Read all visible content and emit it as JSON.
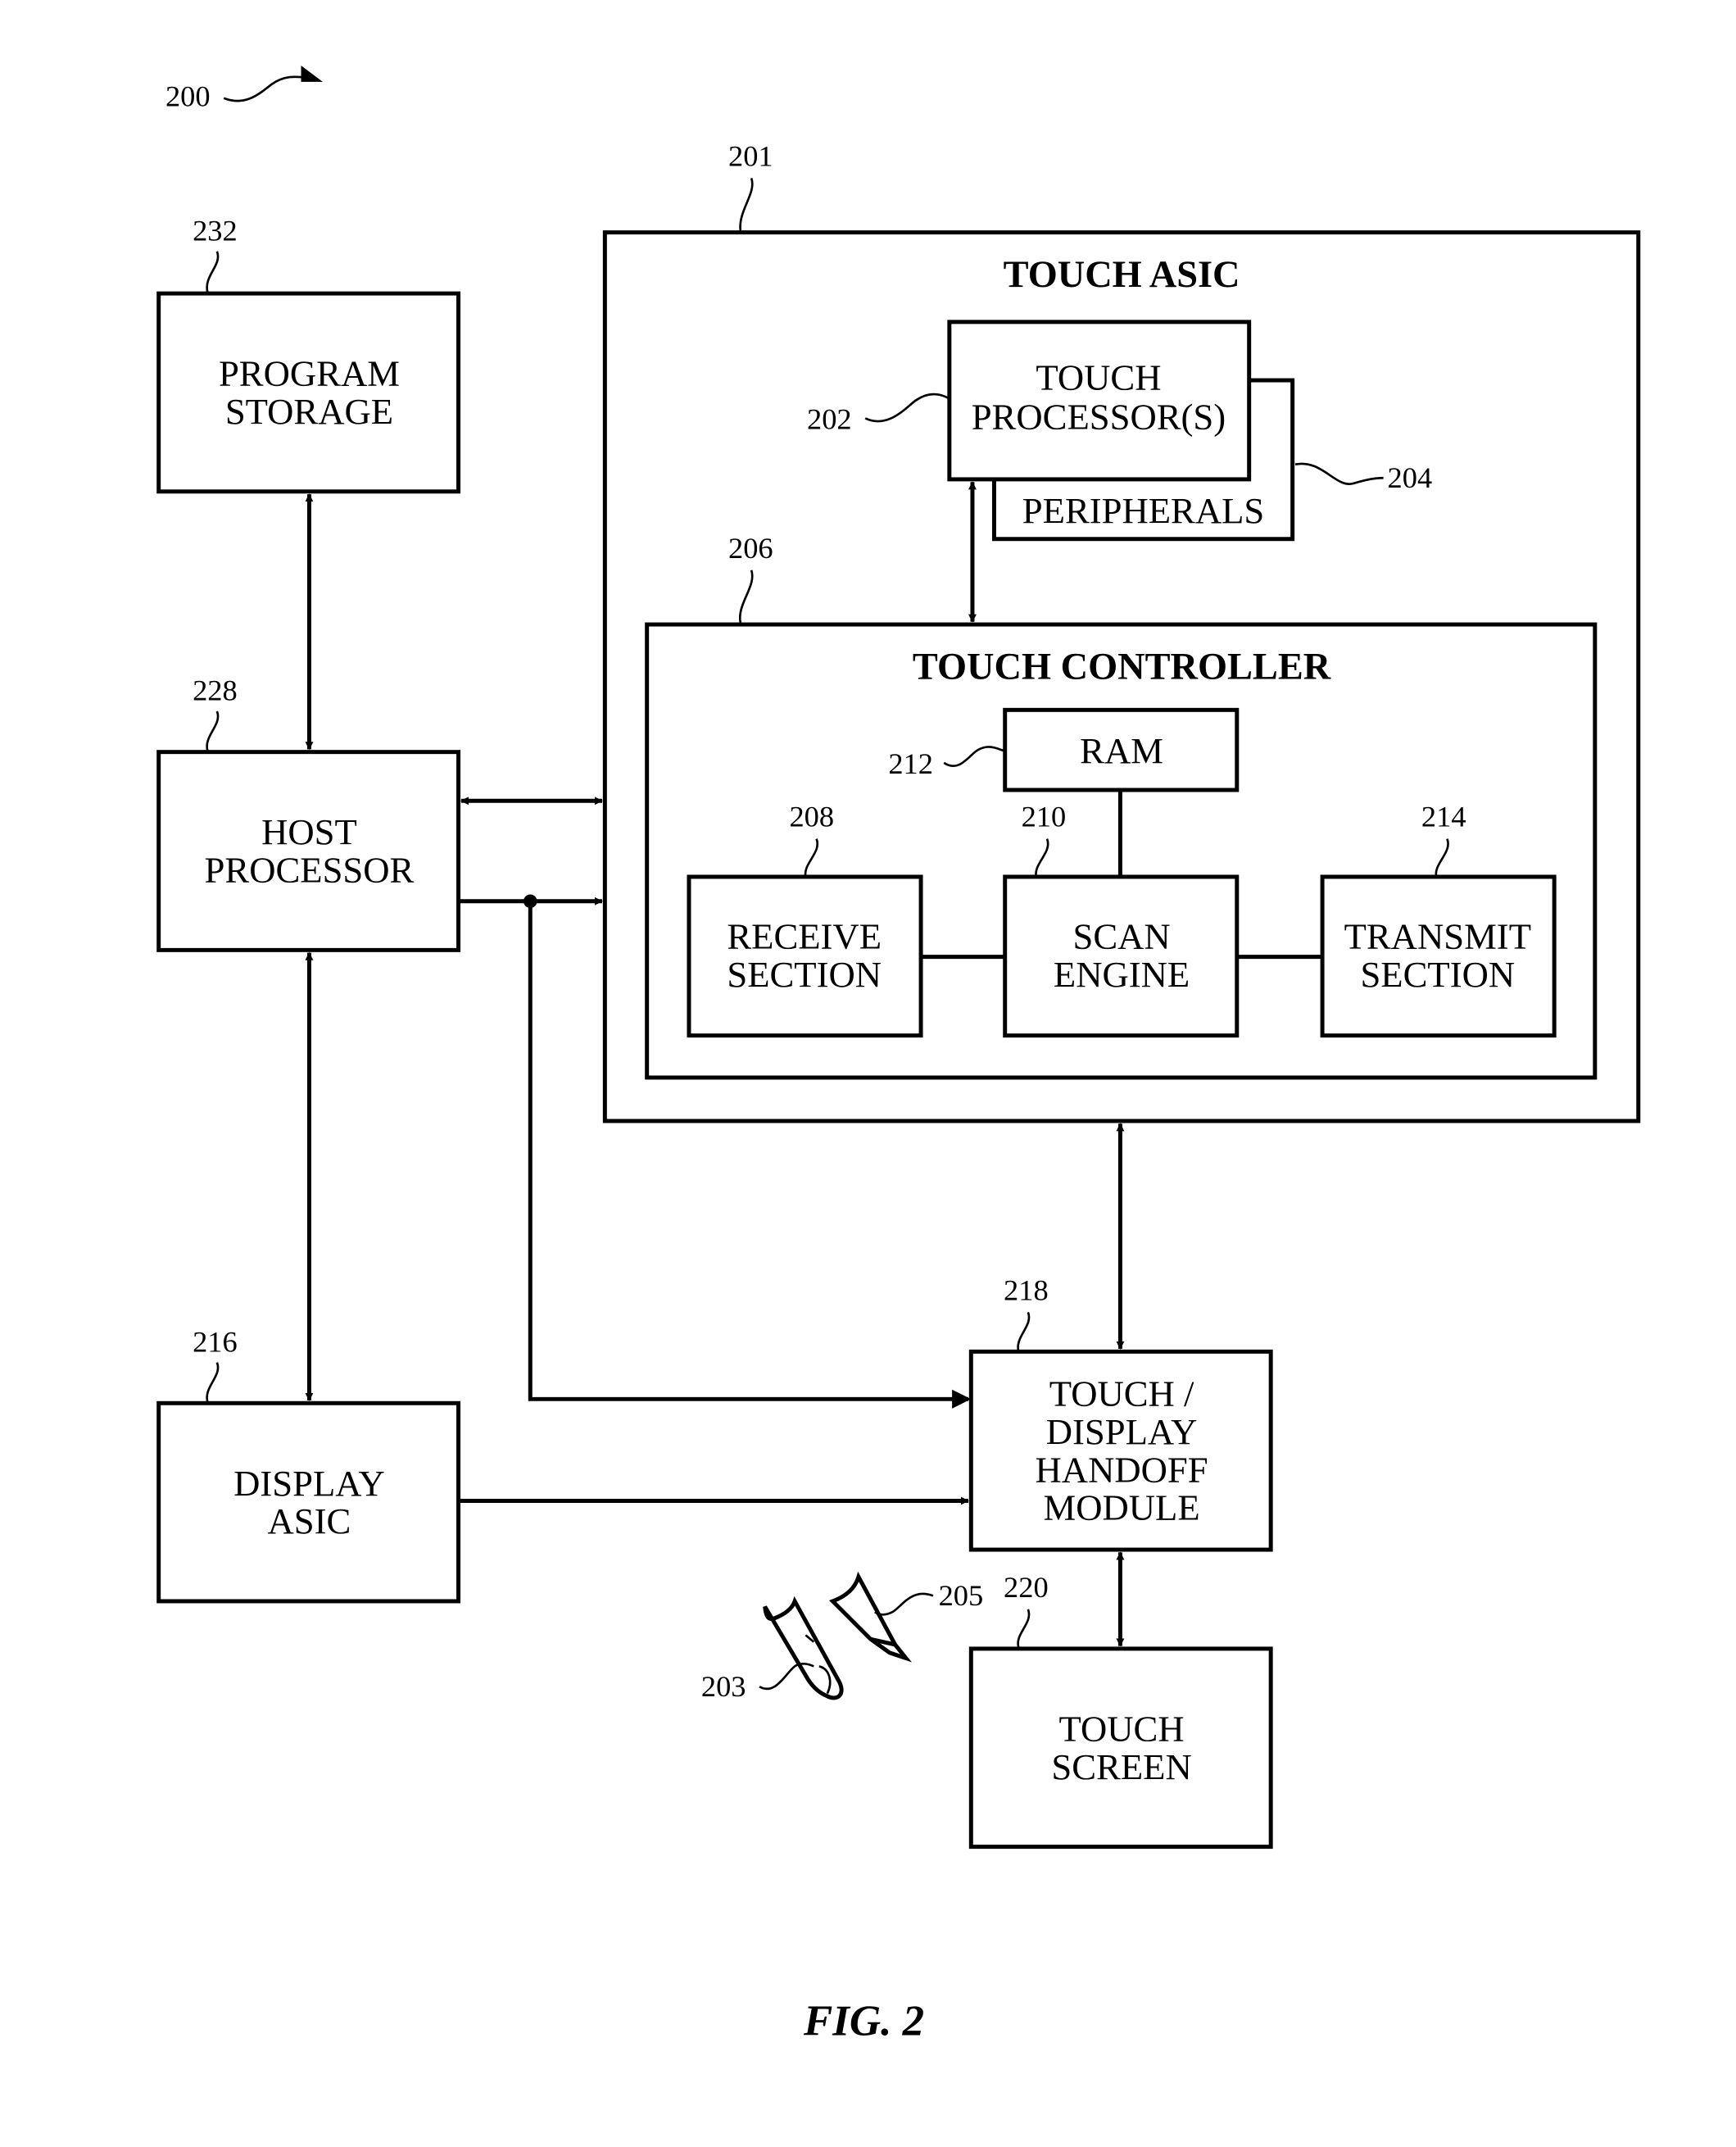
{
  "figure": {
    "number_ref": "200",
    "caption": "FIG. 2",
    "colors": {
      "ink": "#000000",
      "paper": "#ffffff"
    }
  },
  "touch_asic": {
    "ref": "201",
    "title": "TOUCH ASIC",
    "touch_processor": {
      "ref": "202",
      "lines": [
        "TOUCH",
        "PROCESSOR(S)"
      ]
    },
    "peripherals": {
      "ref": "204",
      "label": "PERIPHERALS"
    },
    "touch_controller": {
      "ref": "206",
      "title": "TOUCH CONTROLLER",
      "ram": {
        "ref": "212",
        "label": "RAM"
      },
      "receive_section": {
        "ref": "208",
        "lines": [
          "RECEIVE",
          "SECTION"
        ]
      },
      "scan_engine": {
        "ref": "210",
        "lines": [
          "SCAN",
          "ENGINE"
        ]
      },
      "transmit_section": {
        "ref": "214",
        "lines": [
          "TRANSMIT",
          "SECTION"
        ]
      }
    }
  },
  "program_storage": {
    "ref": "232",
    "lines": [
      "PROGRAM",
      "STORAGE"
    ]
  },
  "host_processor": {
    "ref": "228",
    "lines": [
      "HOST",
      "PROCESSOR"
    ]
  },
  "display_asic": {
    "ref": "216",
    "lines": [
      "DISPLAY",
      "ASIC"
    ]
  },
  "handoff_module": {
    "ref": "218",
    "lines": [
      "TOUCH /",
      "DISPLAY",
      "HANDOFF",
      "MODULE"
    ]
  },
  "touch_screen": {
    "ref": "220",
    "lines": [
      "TOUCH",
      "SCREEN"
    ]
  },
  "finger": {
    "ref": "203"
  },
  "stylus": {
    "ref": "205"
  }
}
